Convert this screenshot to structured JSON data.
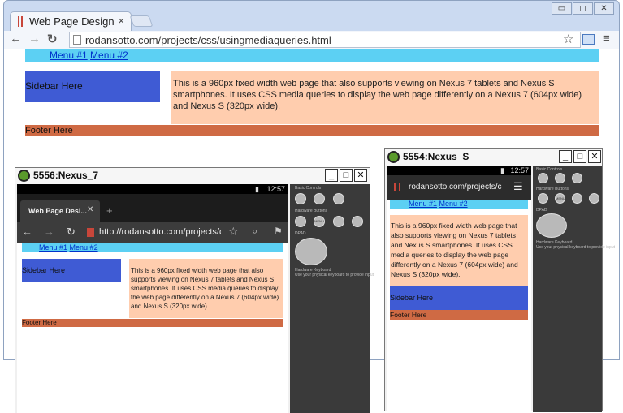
{
  "browser": {
    "tab_title": "Web Page Design Us",
    "tab_close": "×",
    "url": "rodansotto.com/projects/css/usingmediaqueries.html",
    "win_min": "▭",
    "win_max": "◻",
    "win_close": "✕"
  },
  "page": {
    "menu1": "Menu #1",
    "menu2": "Menu #2",
    "sidebar": "Sidebar Here",
    "main": "This is a 960px fixed width web page that also supports viewing on Nexus 7 tablets and Nexus S smartphones. It uses CSS media queries to display the web page differently on a Nexus 7 (604px wide) and Nexus S (320px wide).",
    "footer": "Footer Here"
  },
  "nexus7": {
    "title": "5556:Nexus_7",
    "time": "12:57",
    "tab_title": "Web Page Desi...",
    "url": "http://rodansotto.com/projects/c"
  },
  "nexusS": {
    "title": "5554:Nexus_S",
    "time": "12:57",
    "url": "rodansotto.com/projects/c"
  },
  "controls": {
    "basic": "Basic Controls",
    "hardware": "Hardware Buttons",
    "hardware_note": "(not enabled in AVD)",
    "dpad": "DPAD",
    "dpad_note": "(not enabled in AVD)",
    "keyboard": "Hardware Keyboard",
    "keyboard_note": "Use your physical keyboard to provide input",
    "menu": "MENU"
  },
  "colors": {
    "menu": "#5cd0f3",
    "sidebar": "#3f5bd4",
    "main": "#ffcdae",
    "footer": "#cf6a44"
  }
}
